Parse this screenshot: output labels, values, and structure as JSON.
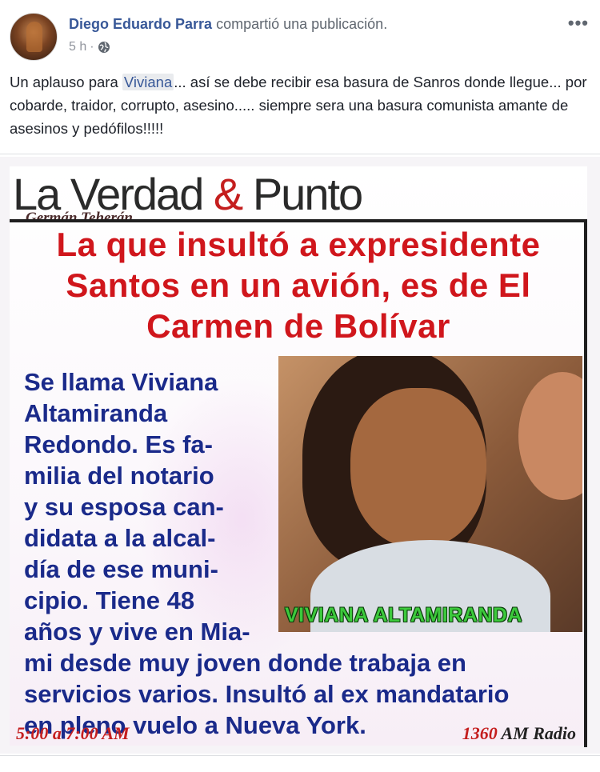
{
  "post": {
    "author": "Diego Eduardo Parra",
    "action": "compartió una publicación.",
    "time": "5 h",
    "separator": "·",
    "privacy_icon": "globe-icon",
    "more_icon": "ellipsis-icon",
    "more_label": "•••",
    "text_before_mention": "Un aplauso para ",
    "mention": "Viviana",
    "text_after_mention": "... así se debe recibir esa basura de Sanros donde llegue... por cobarde, traidor, corrupto, asesino..... siempre sera una basura comunista amante de asesinos y pedófilos!!!!!"
  },
  "image": {
    "logo_left": "La Verdad ",
    "logo_amp": "&",
    "logo_right": " Punto",
    "host": "Germán Teherán",
    "headline": "La que insultó a expresidente Santos en un avión, es de El Carmen de Bolívar",
    "body_narrow": "Se llama Viviana\nAltamiranda\nRedondo. Es fa-\nmilia del notario\ny su esposa can-\ndidata a la alcal-\ndía de ese muni-\ncipio. Tiene 48\naños y vive en Mia-",
    "body_wide": "mi desde muy joven donde trabaja en\nservicios varios. Insultó al ex mandatario\nen pleno vuelo a Nueva York.",
    "photo_caption": "VIVIANA ALTAMIRANDA",
    "time_range": "5:00 a 7:00 AM",
    "station_number": "1360",
    "station_label": " AM Radio"
  },
  "colors": {
    "link": "#385898",
    "headline_red": "#d0161c",
    "body_blue": "#1a2a8a",
    "caption_green": "#3cc93c"
  }
}
